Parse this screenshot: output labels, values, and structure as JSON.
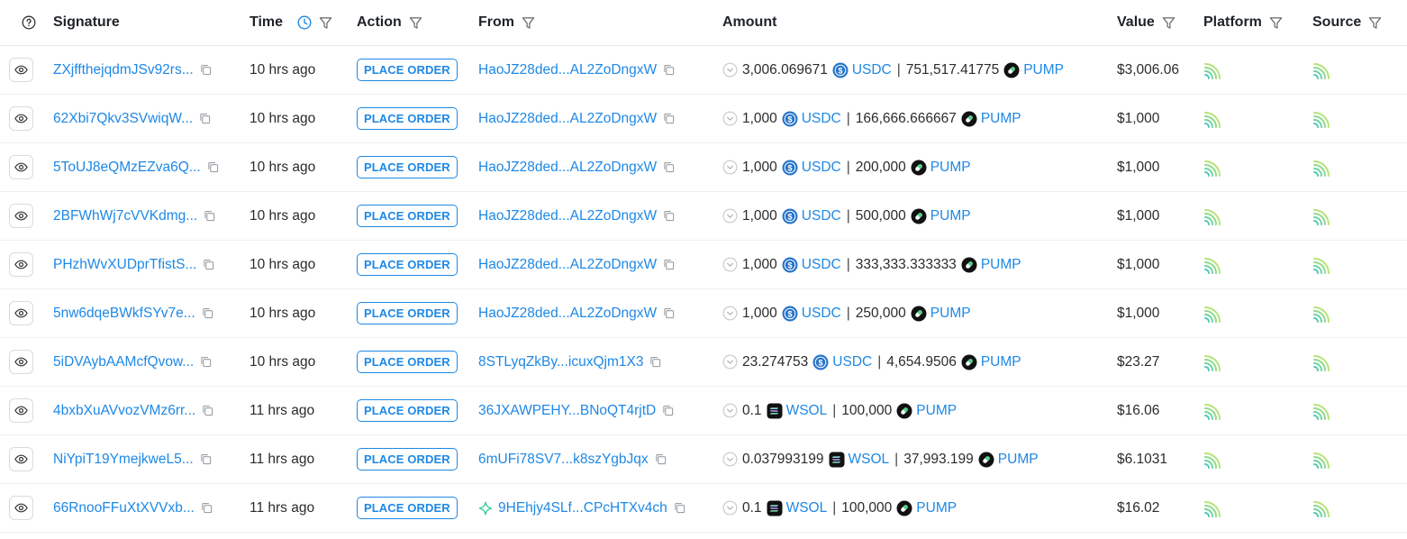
{
  "headers": {
    "signature": "Signature",
    "time": "Time",
    "action": "Action",
    "from": "From",
    "amount": "Amount",
    "value": "Value",
    "platform": "Platform",
    "source": "Source"
  },
  "colors": {
    "link": "#1e88e5",
    "usdc": "#2775ca",
    "wsol": "#111111",
    "pump": "#111111",
    "platform_logo": "#5fd39a"
  },
  "icons": {
    "help": "question-circle-icon",
    "clock": "clock-icon",
    "filter": "filter-icon",
    "eye": "eye-icon",
    "copy": "copy-icon",
    "chevron": "chevron-down-circle-icon",
    "usdc": "usdc-token-icon",
    "wsol": "wsol-token-icon",
    "pump": "pump-token-icon",
    "platform": "platform-logo-icon",
    "source": "source-logo-icon",
    "sparkle": "sparkle-icon"
  },
  "rows": [
    {
      "signature": "ZXjffthejqdmJSv92rs...",
      "time": "10 hrs ago",
      "action": "PLACE ORDER",
      "from": "HaoJZ28ded...AL2ZoDngxW",
      "from_sparkle": false,
      "amount_in": "3,006.069671",
      "token_in": "USDC",
      "amount_out": "751,517.41775",
      "token_out": "PUMP",
      "value": "$3,006.06"
    },
    {
      "signature": "62Xbi7Qkv3SVwiqW...",
      "time": "10 hrs ago",
      "action": "PLACE ORDER",
      "from": "HaoJZ28ded...AL2ZoDngxW",
      "from_sparkle": false,
      "amount_in": "1,000",
      "token_in": "USDC",
      "amount_out": "166,666.666667",
      "token_out": "PUMP",
      "value": "$1,000"
    },
    {
      "signature": "5ToUJ8eQMzEZva6Q...",
      "time": "10 hrs ago",
      "action": "PLACE ORDER",
      "from": "HaoJZ28ded...AL2ZoDngxW",
      "from_sparkle": false,
      "amount_in": "1,000",
      "token_in": "USDC",
      "amount_out": "200,000",
      "token_out": "PUMP",
      "value": "$1,000"
    },
    {
      "signature": "2BFWhWj7cVVKdmg...",
      "time": "10 hrs ago",
      "action": "PLACE ORDER",
      "from": "HaoJZ28ded...AL2ZoDngxW",
      "from_sparkle": false,
      "amount_in": "1,000",
      "token_in": "USDC",
      "amount_out": "500,000",
      "token_out": "PUMP",
      "value": "$1,000"
    },
    {
      "signature": "PHzhWvXUDprTfistS...",
      "time": "10 hrs ago",
      "action": "PLACE ORDER",
      "from": "HaoJZ28ded...AL2ZoDngxW",
      "from_sparkle": false,
      "amount_in": "1,000",
      "token_in": "USDC",
      "amount_out": "333,333.333333",
      "token_out": "PUMP",
      "value": "$1,000"
    },
    {
      "signature": "5nw6dqeBWkfSYv7e...",
      "time": "10 hrs ago",
      "action": "PLACE ORDER",
      "from": "HaoJZ28ded...AL2ZoDngxW",
      "from_sparkle": false,
      "amount_in": "1,000",
      "token_in": "USDC",
      "amount_out": "250,000",
      "token_out": "PUMP",
      "value": "$1,000"
    },
    {
      "signature": "5iDVAybAAMcfQvow...",
      "time": "10 hrs ago",
      "action": "PLACE ORDER",
      "from": "8STLyqZkBy...icuxQjm1X3",
      "from_sparkle": false,
      "amount_in": "23.274753",
      "token_in": "USDC",
      "amount_out": "4,654.9506",
      "token_out": "PUMP",
      "value": "$23.27"
    },
    {
      "signature": "4bxbXuAVvozVMz6rr...",
      "time": "11 hrs ago",
      "action": "PLACE ORDER",
      "from": "36JXAWPEHY...BNoQT4rjtD",
      "from_sparkle": false,
      "amount_in": "0.1",
      "token_in": "WSOL",
      "amount_out": "100,000",
      "token_out": "PUMP",
      "value": "$16.06"
    },
    {
      "signature": "NiYpiT19YmejkweL5...",
      "time": "11 hrs ago",
      "action": "PLACE ORDER",
      "from": "6mUFi78SV7...k8szYgbJqx",
      "from_sparkle": false,
      "amount_in": "0.037993199",
      "token_in": "WSOL",
      "amount_out": "37,993.199",
      "token_out": "PUMP",
      "value": "$6.1031"
    },
    {
      "signature": "66RnooFFuXtXVVxb...",
      "time": "11 hrs ago",
      "action": "PLACE ORDER",
      "from": "9HEhjy4SLf...CPcHTXv4ch",
      "from_sparkle": true,
      "amount_in": "0.1",
      "token_in": "WSOL",
      "amount_out": "100,000",
      "token_out": "PUMP",
      "value": "$16.02"
    }
  ]
}
